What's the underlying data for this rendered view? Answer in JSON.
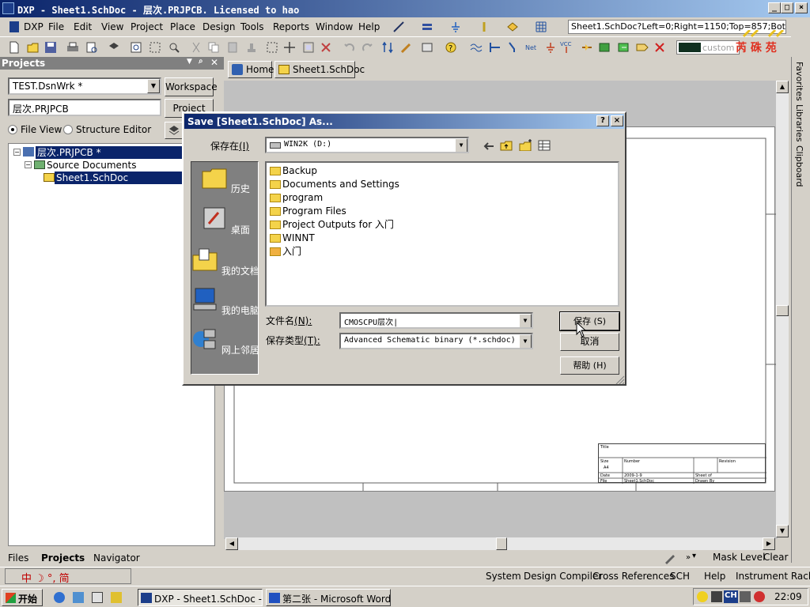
{
  "window": {
    "title": "DXP - Sheet1.SchDoc - 层次.PRJPCB. Licensed to hao",
    "min": "_",
    "max": "□",
    "close": "×"
  },
  "menu": [
    "DXP",
    "File",
    "Edit",
    "View",
    "Project",
    "Place",
    "Design",
    "Tools",
    "Reports",
    "Window",
    "Help"
  ],
  "toolbar": {
    "doc_status": "Sheet1.SchDoc?Left=0;Right=1150;Top=857;Bottom=",
    "color_label": "custom",
    "logo_text": "芮 硃 苑"
  },
  "right_dock": [
    "Favorites",
    "Libraries",
    "Clipboard"
  ],
  "projects_panel": {
    "header": "Projects",
    "workspace_combo": "TEST.DsnWrk *",
    "workspace_button": "Workspace",
    "project_combo": "层次.PRJPCB",
    "project_button": "Project",
    "radio_file_view": "File View",
    "radio_structure": "Structure Editor",
    "tree": [
      {
        "label": "层次.PRJPCB *",
        "level": 0,
        "selected": true
      },
      {
        "label": "Source Documents",
        "level": 1,
        "selected": false
      },
      {
        "label": "Sheet1.SchDoc",
        "level": 2,
        "selected": true
      }
    ],
    "bottom_tabs": [
      "Files",
      "Projects",
      "Navigator"
    ]
  },
  "doc_tabs": [
    "Home",
    "Sheet1.SchDoc"
  ],
  "status_right": {
    "mask_level": "Mask Level",
    "clear": "Clear"
  },
  "bottom_bar": {
    "ime": "中 ☽ °, 简",
    "items": [
      "System",
      "Design Compiler",
      "Cross References",
      "SCH",
      "Help",
      "Instrument Racks"
    ]
  },
  "taskbar": {
    "start": "开始",
    "tasks": [
      "DXP - Sheet1.SchDoc - 层...",
      "第二张 - Microsoft Word"
    ],
    "tray_lang": "CH",
    "clock": "22:09"
  },
  "dialog": {
    "title": "Save [Sheet1.SchDoc] As...",
    "help_btn": "?",
    "close_btn": "×",
    "save_in_label": "保存在",
    "save_in_key": "(I)",
    "save_in_value": "WIN2K (D:)",
    "places": [
      "历史",
      "桌面",
      "我的文档",
      "我的电脑",
      "网上邻居"
    ],
    "files": [
      "Backup",
      "Documents and Settings",
      "program",
      "Program Files",
      "Project Outputs for 入门",
      "WINNT",
      "入门"
    ],
    "filename_label": "文件名",
    "filename_key": "(N):",
    "filename_value": "CMOSCPU层次|",
    "filetype_label": "保存类型",
    "filetype_key": "(T):",
    "filetype_value": "Advanced Schematic binary (*.schdoc)",
    "save_button": "保存 (S)",
    "cancel_button": "取消",
    "help_button": "帮助 (H)"
  },
  "sheet": {
    "title_block": {
      "title": "Title",
      "size": "Size",
      "size_val": "A4",
      "number": "Number",
      "revision": "Revision",
      "date": "Date",
      "date_val": "2009-1-9",
      "sheet_of": "Sheet of",
      "file": "File",
      "file_val": "Sheet1.SchDoc",
      "drawn_by": "Drawn By"
    }
  },
  "colors": {
    "title_active": "#0a246a",
    "title_gradient_end": "#a6caf0",
    "selection": "#0a246a",
    "face": "#d4d0c8"
  }
}
